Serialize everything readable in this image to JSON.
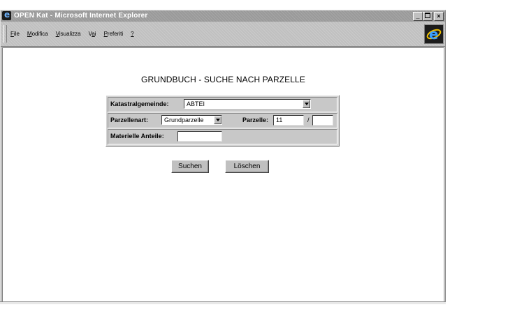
{
  "window": {
    "title": "OPEN Kat - Microsoft Internet Explorer",
    "controls": {
      "minimize": "_",
      "maximize": " ",
      "close": "×"
    }
  },
  "menu": {
    "items": [
      {
        "accel": "F",
        "rest": "ile"
      },
      {
        "accel": "M",
        "rest": "odifica"
      },
      {
        "accel": "V",
        "rest": "isualizza"
      },
      {
        "pre": "V",
        "accel": "a",
        "rest": "i"
      },
      {
        "accel": "P",
        "rest": "referiti"
      },
      {
        "accel": "?",
        "rest": ""
      }
    ]
  },
  "page": {
    "title": "GRUNDBUCH - SUCHE NACH PARZELLE",
    "form": {
      "katastralgemeinde_label": "Katastralgemeinde:",
      "katastralgemeinde_value": "ABTEI",
      "parzellenart_label": "Parzellenart:",
      "parzellenart_value": "Grundparzelle",
      "parzelle_label": "Parzelle:",
      "parzelle_value": "11",
      "parzelle_separator": "/",
      "parzelle_sub_value": "",
      "materielle_label": "Materielle Anteile:",
      "materielle_value": ""
    },
    "buttons": {
      "search": "Suchen",
      "clear": "Löschen"
    }
  },
  "icons": {
    "app": "ie-app-icon",
    "brand": "internet-explorer-logo-icon",
    "dropdown": "dropdown-arrow-icon"
  }
}
